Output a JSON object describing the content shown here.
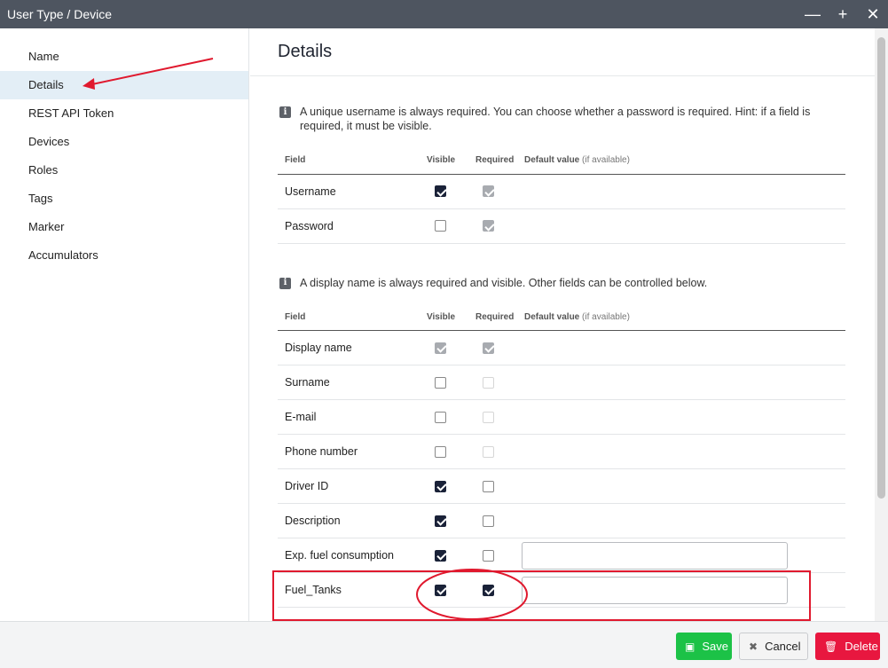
{
  "window": {
    "title": "User Type / Device"
  },
  "sidebar": {
    "items": [
      {
        "label": "Name",
        "active": false
      },
      {
        "label": "Details",
        "active": true
      },
      {
        "label": "REST API Token",
        "active": false
      },
      {
        "label": "Devices",
        "active": false
      },
      {
        "label": "Roles",
        "active": false
      },
      {
        "label": "Tags",
        "active": false
      },
      {
        "label": "Marker",
        "active": false
      },
      {
        "label": "Accumulators",
        "active": false
      }
    ]
  },
  "main": {
    "title": "Details",
    "section1": {
      "info": "A unique username is always required. You can choose whether a password is required. Hint: if a field is required, it must be visible.",
      "headers": {
        "field": "Field",
        "visible": "Visible",
        "required": "Required",
        "default": "Default value",
        "default_note": "(if available)"
      },
      "rows": [
        {
          "field": "Username",
          "visible": "checked",
          "required": "checked-disabled"
        },
        {
          "field": "Password",
          "visible": "unchecked",
          "required": "checked-disabled"
        }
      ]
    },
    "section2": {
      "info": "A display name is always required and visible. Other fields can be controlled below.",
      "headers": {
        "field": "Field",
        "visible": "Visible",
        "required": "Required",
        "default": "Default value",
        "default_note": "(if available)"
      },
      "rows": [
        {
          "field": "Display name",
          "visible": "checked-disabled",
          "required": "checked-disabled"
        },
        {
          "field": "Surname",
          "visible": "unchecked",
          "required": "disabled"
        },
        {
          "field": "E-mail",
          "visible": "unchecked",
          "required": "disabled"
        },
        {
          "field": "Phone number",
          "visible": "unchecked",
          "required": "disabled"
        },
        {
          "field": "Driver ID",
          "visible": "checked",
          "required": "unchecked"
        },
        {
          "field": "Description",
          "visible": "checked",
          "required": "unchecked"
        },
        {
          "field": "Exp. fuel consumption",
          "visible": "checked",
          "required": "unchecked",
          "default_value": ""
        },
        {
          "field": "Fuel_Tanks",
          "visible": "checked",
          "required": "checked",
          "default_value": ""
        }
      ]
    }
  },
  "footer": {
    "save_label": "Save",
    "cancel_label": "Cancel",
    "delete_label": "Delete"
  },
  "colors": {
    "save": "#1cc247",
    "delete": "#e8173f",
    "annotation": "#e0192e",
    "active_item": "#e3eef6"
  }
}
